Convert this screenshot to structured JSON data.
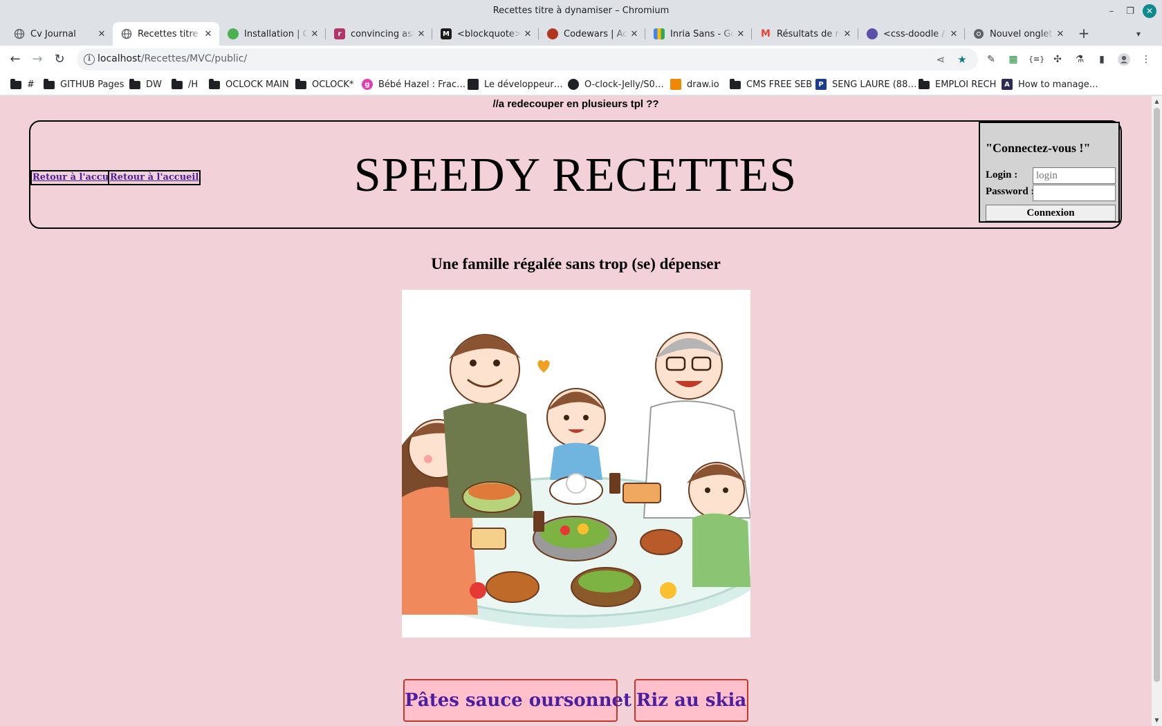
{
  "window": {
    "title": "Recettes titre à dynamiser – Chromium",
    "minimize": "–",
    "maximize": "❐",
    "close": "✕"
  },
  "tabs": [
    {
      "label": "Cv Journal",
      "icon": "globe-icon"
    },
    {
      "label": "Recettes titre à dynamiser",
      "icon": "globe-icon",
      "active": true
    },
    {
      "label": "Installation | Gatsby",
      "icon": "gatsby-icon"
    },
    {
      "label": "convincing asian",
      "icon": "brand-icon"
    },
    {
      "label": "<blockquote>",
      "icon": "mdn-icon"
    },
    {
      "label": "Codewars | Achieve",
      "icon": "codewars-icon"
    },
    {
      "label": "Inria Sans - Google",
      "icon": "google-fonts-icon"
    },
    {
      "label": "Résultats de recherche",
      "icon": "gmail-icon"
    },
    {
      "label": "<css-doodle />",
      "icon": "css-doodle-icon"
    },
    {
      "label": "Nouvel onglet",
      "icon": "chrome-icon"
    }
  ],
  "toolbar": {
    "url_host": "localhost",
    "url_path": "/Recettes/MVC/public/"
  },
  "bookmarks": [
    {
      "label": "#",
      "icon": "folder-icon"
    },
    {
      "label": "GITHUB Pages",
      "icon": "folder-icon"
    },
    {
      "label": "DW",
      "icon": "folder-icon"
    },
    {
      "label": "/H",
      "icon": "folder-icon"
    },
    {
      "label": "OCLOCK MAIN",
      "icon": "folder-icon"
    },
    {
      "label": "OCLOCK*",
      "icon": "folder-icon"
    },
    {
      "label": "Bébé Hazel : Frac…",
      "icon": "brand-icon"
    },
    {
      "label": "Le développeur…",
      "icon": "monitor-icon"
    },
    {
      "label": "O-clock-Jelly/S0…",
      "icon": "github-icon"
    },
    {
      "label": "draw.io",
      "icon": "drawio-icon"
    },
    {
      "label": "CMS FREE SEB",
      "icon": "folder-icon"
    },
    {
      "label": "SENG LAURE (88…",
      "icon": "p-icon"
    },
    {
      "label": "EMPLOI RECH",
      "icon": "folder-icon"
    },
    {
      "label": "How to manage…",
      "icon": "brand-icon"
    }
  ],
  "page": {
    "dev_note": "//a redecouper en plusieurs tpl ??",
    "home_links": [
      "Retour à l'accueil",
      "Retour à l'accueil"
    ],
    "site_title": "SPEEDY RECETTES",
    "login": {
      "title": "\"Connectez-vous !\"",
      "login_label": "Login :",
      "login_placeholder": "login",
      "password_label": "Password :",
      "submit": "Connexion"
    },
    "tagline": "Une famille régalée sans trop (se) dépenser",
    "recipes": [
      "Pâtes sauce oursonnet",
      "Riz au skia"
    ]
  },
  "colors": {
    "page_background": "#f3d1d8",
    "link": "#4b1fa0",
    "recipe_button_bg": "#ffc0cb",
    "recipe_button_border": "#c0392b",
    "login_box": "#d3d3d3"
  }
}
